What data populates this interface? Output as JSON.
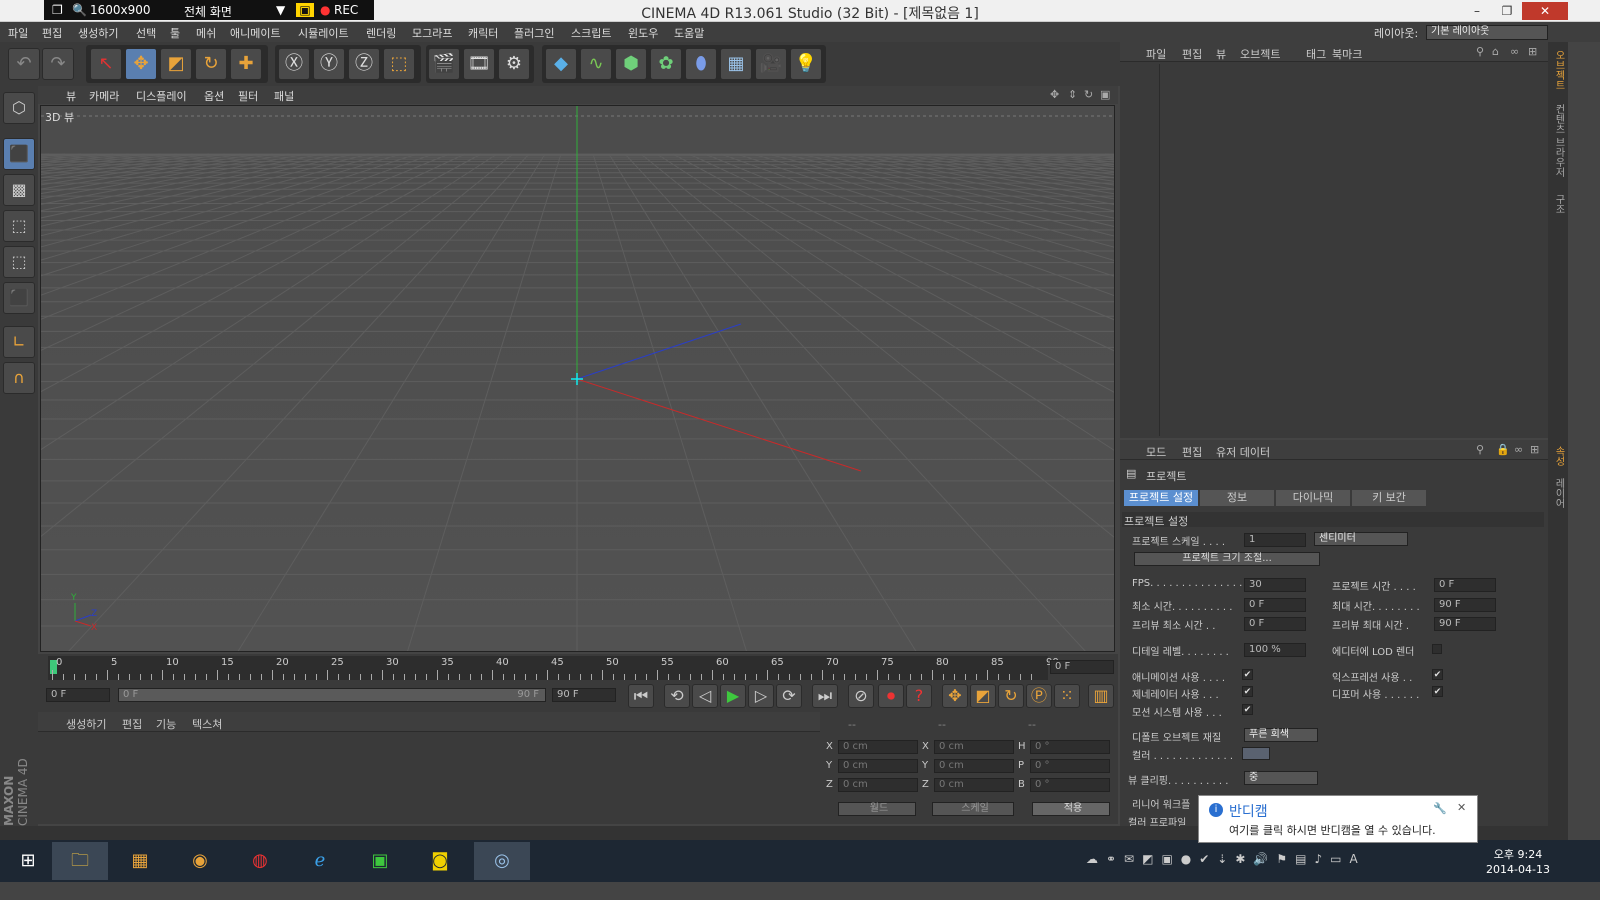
{
  "window": {
    "title": "CINEMA 4D R13.061 Studio (32 Bit) - [제목없음 1]"
  },
  "recorder": {
    "resolution": "1600x900",
    "mode": "전체 화면",
    "rec": "REC"
  },
  "menu": [
    "파일",
    "편집",
    "생성하기",
    "선택",
    "툴",
    "메쉬",
    "애니메이트",
    "시뮬레이트",
    "렌더링",
    "모그라프",
    "캐릭터",
    "플러그인",
    "스크립트",
    "윈도우",
    "도움말"
  ],
  "layout": {
    "label": "레이아웃:",
    "value": "기본 레이아웃"
  },
  "viewport": {
    "menu": [
      "뷰",
      "카메라",
      "디스플레이",
      "옵션",
      "필터",
      "패널"
    ],
    "label": "3D 뷰"
  },
  "timeline": {
    "ticks": [
      "0",
      "5",
      "10",
      "15",
      "20",
      "25",
      "30",
      "35",
      "40",
      "45",
      "50",
      "55",
      "60",
      "65",
      "70",
      "75",
      "80",
      "85",
      "90"
    ],
    "current": "0 F",
    "start": "0 F",
    "range_start": "0 F",
    "range_end": "90 F",
    "end": "90 F"
  },
  "material": {
    "menu": [
      "생성하기",
      "편집",
      "기능",
      "텍스쳐"
    ]
  },
  "coords": {
    "headers": [
      "--",
      "--",
      "--"
    ],
    "rows": [
      [
        "X",
        "0 cm",
        "X",
        "0 cm",
        "H",
        "0 °"
      ],
      [
        "Y",
        "0 cm",
        "Y",
        "0 cm",
        "P",
        "0 °"
      ],
      [
        "Z",
        "0 cm",
        "Z",
        "0 cm",
        "B",
        "0 °"
      ]
    ],
    "world": "월드",
    "scale": "스케일",
    "apply": "적용"
  },
  "objmgr": {
    "menu": [
      "파일",
      "편집",
      "뷰",
      "오브젝트",
      "태그",
      "북마크"
    ]
  },
  "attr": {
    "menu": [
      "모드",
      "편집",
      "유저 데이터"
    ],
    "title": "프로젝트",
    "tabs": [
      "프로젝트 설정",
      "정보",
      "다이나믹",
      "키 보간"
    ],
    "section": "프로젝트 설정",
    "scale_label": "프로젝트 스케일 . . . .",
    "scale_val": "1",
    "scale_unit": "센티미터",
    "size_btn": "프로젝트 크기 조절...",
    "fps_label": "FPS. . . . . . . . . . . . . . .",
    "fps_val": "30",
    "ptime_label": "프로젝트 시간 . . . .",
    "ptime_val": "0 F",
    "min_label": "최소 시간. . . . . . . . . .",
    "min_val": "0 F",
    "max_label": "최대 시간. . . . . . . .",
    "max_val": "90 F",
    "pmin_label": "프리뷰 최소 시간 . .",
    "pmin_val": "0 F",
    "pmax_label": "프리뷰 최대 시간 .",
    "pmax_val": "90 F",
    "detail_label": "디테일 레벨. . . . . . . .",
    "detail_val": "100 %",
    "lod_label": "에디터에 LOD 렌더",
    "anim_label": "애니메이션 사용 . . . .",
    "expr_label": "익스프레션 사용 . .",
    "gen_label": "제네레이터 사용 . . .",
    "deform_label": "디포머 사용 . . . . . .",
    "motion_label": "모션 시스템 사용 . . .",
    "defobj_label": "디폴트 오브젝트 재질",
    "defobj_val": "푸른 회색",
    "color_label": "컬러 . . . . . . . . . . . . .",
    "clip_label": "뷰 클리핑. . . . . . . . . .",
    "clip_val": "중",
    "linear_label": "리니어 워크플",
    "colorprof_label": "컬러 프로파일"
  },
  "rightstrip": [
    "오브젝트",
    "컨텐츠 브라우저",
    "구조",
    "속성",
    "레이어"
  ],
  "notification": {
    "title": "반디캠",
    "body": "여기를 클릭 하시면 반디캠을 열 수 있습니다."
  },
  "tray": {
    "time": "오후 9:24",
    "date": "2014-04-13"
  },
  "brand": {
    "maxon": "MAXON",
    "c4d": "CINEMA 4D"
  }
}
